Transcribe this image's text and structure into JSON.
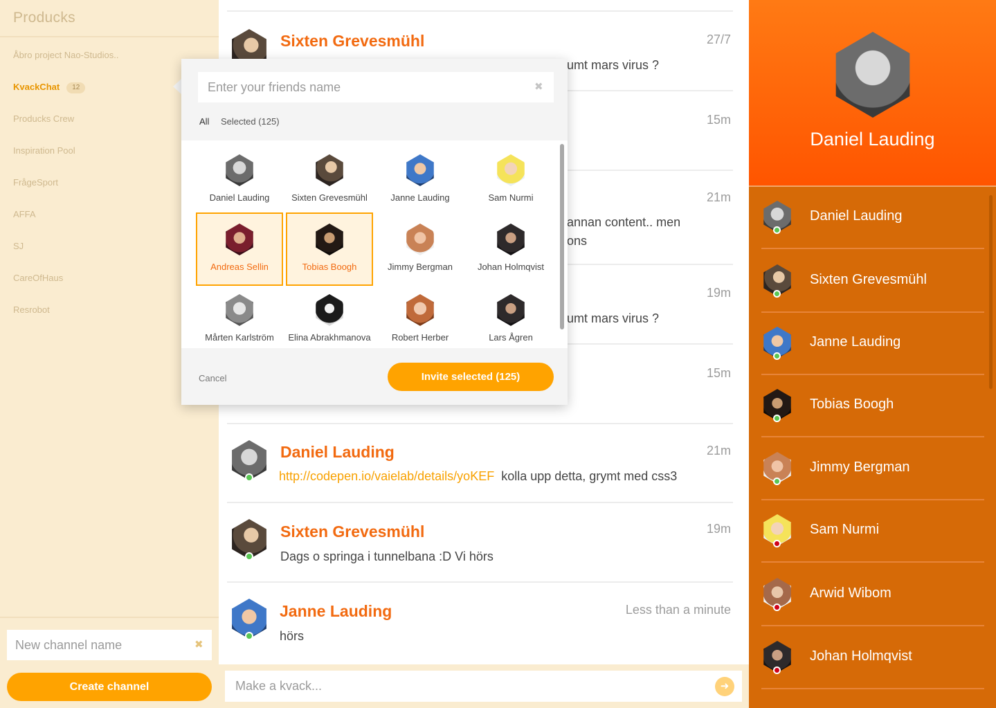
{
  "sidebar": {
    "brand": "Producks",
    "channels": [
      {
        "label": "Åbro project Nao-Studios..",
        "active": false
      },
      {
        "label": "KvackChat",
        "active": true,
        "badge": "12"
      },
      {
        "label": "Producks Crew",
        "active": false
      },
      {
        "label": "Inspiration Pool",
        "active": false
      },
      {
        "label": "FrågeSport",
        "active": false
      },
      {
        "label": "AFFA",
        "active": false
      },
      {
        "label": "SJ",
        "active": false
      },
      {
        "label": "CareOfHaus",
        "active": false
      },
      {
        "label": "Resrobot",
        "active": false
      }
    ],
    "new_channel_placeholder": "New channel name",
    "create_label": "Create channel"
  },
  "messages": [
    {
      "name": "Sixten Grevesmühl",
      "time": "27/7",
      "text": "umt mars virus ?",
      "avatar": "t2"
    },
    {
      "name": "",
      "time": "15m",
      "text": "",
      "avatar": ""
    },
    {
      "name": "",
      "time": "21m",
      "text": "annan content.. men",
      "text2": "ons",
      "avatar": ""
    },
    {
      "name": "",
      "time": "19m",
      "text": "umt mars virus ?",
      "avatar": ""
    },
    {
      "name": "",
      "time": "15m",
      "text": "",
      "avatar": ""
    },
    {
      "name": "Daniel Lauding",
      "time": "21m",
      "link": "http://codepen.io/vaielab/details/yoKEF",
      "text": "kolla upp detta, grymt med css3",
      "avatar": "t1"
    },
    {
      "name": "Sixten Grevesmühl",
      "time": "19m",
      "text": "Dags o springa i tunnelbana :D Vi hörs",
      "avatar": "t2"
    },
    {
      "name": "Janne Lauding",
      "time": "Less than a minute",
      "text": "hörs",
      "avatar": "t3"
    }
  ],
  "composer": {
    "placeholder": "Make a kvack...",
    "send_icon": "arrow-right-icon"
  },
  "profile": {
    "name": "Daniel Lauding"
  },
  "members": [
    {
      "name": "Daniel Lauding",
      "status": "online",
      "avatar": "t1"
    },
    {
      "name": "Sixten Grevesmühl",
      "status": "online",
      "avatar": "t2"
    },
    {
      "name": "Janne Lauding",
      "status": "online",
      "avatar": "t3"
    },
    {
      "name": "Tobias Boogh",
      "status": "online",
      "avatar": "t6"
    },
    {
      "name": "Jimmy Bergman",
      "status": "online",
      "avatar": "t7"
    },
    {
      "name": "Sam Nurmi",
      "status": "offline",
      "avatar": "t4"
    },
    {
      "name": "Arwid Wibom",
      "status": "offline",
      "avatar": "t12"
    },
    {
      "name": "Johan Holmqvist",
      "status": "offline",
      "avatar": "t8"
    }
  ],
  "status_colors": {
    "online": "#59c653",
    "offline": "#d0021b"
  },
  "invite": {
    "placeholder": "Enter your friends name",
    "filter_all": "All",
    "filter_selected": "Selected (125)",
    "friends": [
      {
        "name": "Daniel Lauding",
        "selected": false,
        "avatar": "t1"
      },
      {
        "name": "Sixten Grevesmühl",
        "selected": false,
        "avatar": "t2"
      },
      {
        "name": "Janne Lauding",
        "selected": false,
        "avatar": "t3"
      },
      {
        "name": "Sam Nurmi",
        "selected": false,
        "avatar": "t4"
      },
      {
        "name": "Andreas Sellin",
        "selected": true,
        "avatar": "t5"
      },
      {
        "name": "Tobias Boogh",
        "selected": true,
        "avatar": "t6"
      },
      {
        "name": "Jimmy Bergman",
        "selected": false,
        "avatar": "t7"
      },
      {
        "name": "Johan Holmqvist",
        "selected": false,
        "avatar": "t8"
      },
      {
        "name": "Mårten Karlström",
        "selected": false,
        "avatar": "t9"
      },
      {
        "name": "Elina Abrakhmanova",
        "selected": false,
        "avatar": "t10"
      },
      {
        "name": "Robert Herber",
        "selected": false,
        "avatar": "t11"
      },
      {
        "name": "Lars Ågren",
        "selected": false,
        "avatar": "t8"
      }
    ],
    "cancel_label": "Cancel",
    "invite_label": "Invite selected (125)"
  },
  "colors": {
    "accent": "#ffa300",
    "name": "#f26a10",
    "panel": "#d66a07"
  }
}
